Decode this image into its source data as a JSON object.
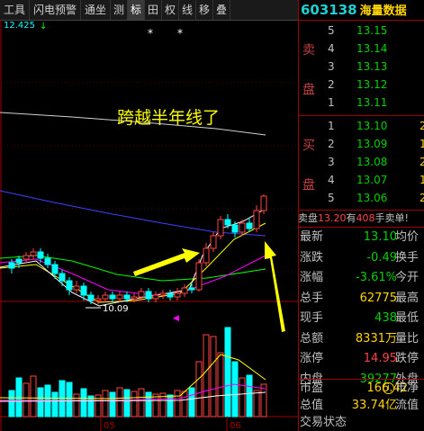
{
  "toolbar": {
    "items": [
      "工具",
      "闪电预警",
      "通坐",
      "测",
      "标",
      "田",
      "权",
      "线",
      "移",
      "叠"
    ],
    "selected_index": 4
  },
  "chart": {
    "price_label": "12.425",
    "annotation": "跨越半年线了",
    "low_price_label": "10.09",
    "month_labels": [
      "05",
      "06"
    ],
    "colors": {
      "up": "#ff4444",
      "down": "#00ffff",
      "ma_white": "#ffffff",
      "ma_yellow": "#ffff00",
      "ma_magenta": "#ff00ff",
      "ma_green": "#00ff00",
      "ma_blue": "#4040ff",
      "annotation": "#ffff00",
      "axis": "#a00000"
    }
  },
  "header": {
    "code": "603138",
    "name": "海量数据"
  },
  "order_book": {
    "sell_labels": [
      "卖",
      "盘"
    ],
    "buy_labels": [
      "买",
      "盘"
    ],
    "sell": [
      {
        "level": "5",
        "price": "13.15"
      },
      {
        "level": "4",
        "price": "13.14"
      },
      {
        "level": "3",
        "price": "13.13"
      },
      {
        "level": "2",
        "price": "13.12"
      },
      {
        "level": "1",
        "price": "13.11"
      }
    ],
    "buy": [
      {
        "level": "1",
        "price": "13.10",
        "vol": "2"
      },
      {
        "level": "2",
        "price": "13.09",
        "vol": "1"
      },
      {
        "level": "3",
        "price": "13.08",
        "vol": "2"
      },
      {
        "level": "4",
        "price": "13.07",
        "vol": "1"
      },
      {
        "level": "5",
        "price": "13.06",
        "vol": "2"
      }
    ]
  },
  "big_order": {
    "prefix": "卖盘",
    "price": "13.20",
    "mid": "有",
    "qty": "408",
    "suffix": "手卖单!"
  },
  "stats": [
    {
      "label": "最新",
      "value": "13.10",
      "color": "dn",
      "label2": "均价"
    },
    {
      "label": "涨跌",
      "value": "-0.49",
      "color": "dn",
      "label2": "换手"
    },
    {
      "label": "涨幅",
      "value": "-3.61%",
      "color": "dn",
      "label2": "今开"
    },
    {
      "label": "总手",
      "value": "62775",
      "color": "y",
      "label2": "最高"
    },
    {
      "label": "现手",
      "value": "438",
      "color": "dn",
      "label2": "最低"
    },
    {
      "label": "总额",
      "value": "8331万",
      "color": "y",
      "label2": "量比"
    },
    {
      "label": "涨停",
      "value": "14.95",
      "color": "up",
      "label2": "跌停"
    },
    {
      "label": "内盘",
      "value": "39277",
      "color": "dn",
      "label2": "外盘"
    }
  ],
  "bottom": [
    {
      "label": "市盈",
      "value": "166.42",
      "icon": "i",
      "label2": "市净"
    },
    {
      "label": "总值",
      "value": "33.74亿",
      "label2": "流值"
    },
    {
      "label": "交易状态",
      "value": "",
      "label2": ""
    }
  ]
}
